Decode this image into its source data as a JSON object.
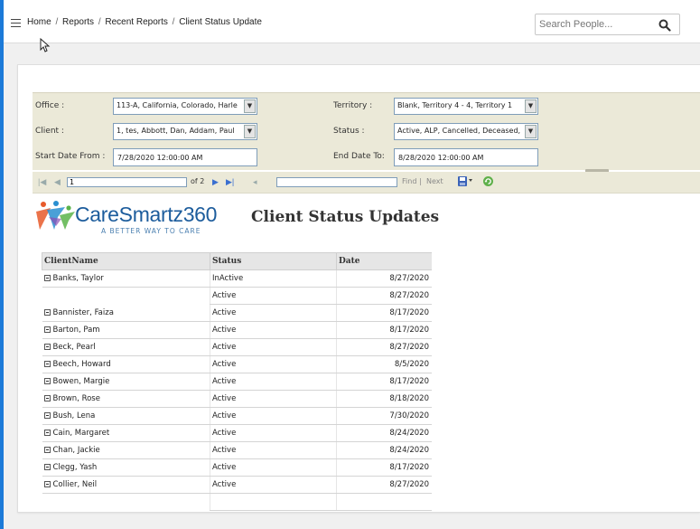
{
  "breadcrumb": {
    "items": [
      "Home",
      "Reports",
      "Recent Reports",
      "Client Status Update"
    ],
    "separator": "/"
  },
  "search": {
    "placeholder": "Search People..."
  },
  "parameters": {
    "office_label": "Office :",
    "office_value": "113-A, California, Colorado, Harle",
    "client_label": "Client :",
    "client_value": "1, tes, Abbott, Dan, Addam, Paul",
    "start_date_label": "Start Date From :",
    "start_date_value": "7/28/2020 12:00:00 AM",
    "territory_label": "Territory :",
    "territory_value": "Blank, Territory 4 - 4, Territory 1",
    "status_label": "Status :",
    "status_value": "Active, ALP, Cancelled, Deceased,",
    "end_date_label": "End Date To:",
    "end_date_value": "8/28/2020 12:00:00 AM"
  },
  "toolbar": {
    "page_value": "1",
    "of_text": "of 2",
    "find_label": "Find",
    "separator": "|",
    "next_label": "Next"
  },
  "report": {
    "logo_text": "CareSmartz360",
    "tagline": "A BETTER WAY TO CARE",
    "title": "Client Status Updates",
    "columns": [
      "ClientName",
      "Status",
      "Date"
    ],
    "rows": [
      {
        "name": "Banks, Taylor",
        "status": "InActive",
        "date": "8/27/2020"
      },
      {
        "name": "",
        "status": "Active",
        "date": "8/27/2020"
      },
      {
        "name": "Bannister, Faiza",
        "status": "Active",
        "date": "8/17/2020"
      },
      {
        "name": "Barton, Pam",
        "status": "Active",
        "date": "8/17/2020"
      },
      {
        "name": "Beck, Pearl",
        "status": "Active",
        "date": "8/27/2020"
      },
      {
        "name": "Beech, Howard",
        "status": "Active",
        "date": "8/5/2020"
      },
      {
        "name": "Bowen, Margie",
        "status": "Active",
        "date": "8/17/2020"
      },
      {
        "name": "Brown, Rose",
        "status": "Active",
        "date": "8/18/2020"
      },
      {
        "name": "Bush, Lena",
        "status": "Active",
        "date": "7/30/2020"
      },
      {
        "name": "Cain, Margaret",
        "status": "Active",
        "date": "8/24/2020"
      },
      {
        "name": "Chan, Jackie",
        "status": "Active",
        "date": "8/24/2020"
      },
      {
        "name": "Clegg, Yash",
        "status": "Active",
        "date": "8/17/2020"
      },
      {
        "name": "Collier, Neil",
        "status": "Active",
        "date": "8/27/2020"
      },
      {
        "name": "",
        "status": "",
        "date": ""
      }
    ]
  },
  "colors": {
    "accent_strip": "#1c7ad8",
    "params_bg": "#ebe9d8",
    "logo_blue": "#1c5c9c"
  },
  "icons": [
    "menu-icon",
    "mouse-cursor-icon",
    "search-icon",
    "first-page-icon",
    "prev-page-icon",
    "next-page-icon",
    "last-page-icon",
    "back-icon",
    "export-icon",
    "refresh-icon",
    "logo-figures-icon",
    "expand-toggle-icon"
  ]
}
